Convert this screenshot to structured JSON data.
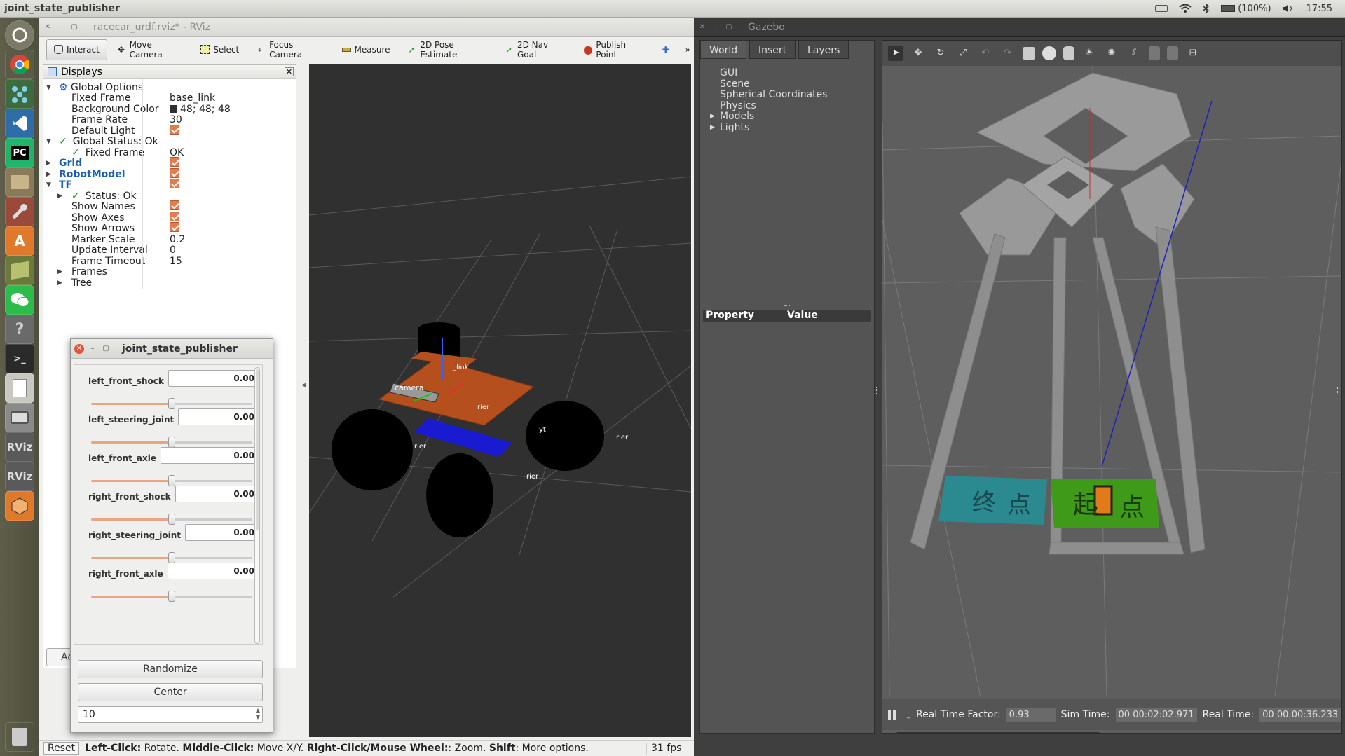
{
  "topbar": {
    "title": "joint_state_publisher",
    "battery": "(100%)",
    "time": "17:55"
  },
  "launcher": {
    "items": [
      "ubuntu-dash-icon",
      "chrome-icon",
      "robot-icon",
      "vscode-icon",
      "pycharm-icon",
      "files-icon",
      "settings-icon",
      "software-center-icon",
      "notes-icon",
      "wechat-icon",
      "help-icon",
      "terminal-icon",
      "text-editor-icon",
      "camera-icon",
      "rviz-icon",
      "rviz-icon",
      "blender-icon",
      "trash-icon"
    ],
    "labels": {
      "rviz": "RViz",
      "pycharm": "PC"
    }
  },
  "rviz": {
    "title": "racecar_urdf.rviz* - RViz",
    "toolbar": [
      "Interact",
      "Move Camera",
      "Select",
      "Focus Camera",
      "Measure",
      "2D Pose Estimate",
      "2D Nav Goal",
      "Publish Point"
    ],
    "displays_title": "Displays",
    "tree": [
      {
        "k": "Global Options",
        "v": "",
        "lvl": 0,
        "arrow": "▼",
        "icon": "gear"
      },
      {
        "k": "Fixed Frame",
        "v": "base_link",
        "lvl": 1
      },
      {
        "k": "Background Color",
        "v": "48; 48; 48",
        "lvl": 1,
        "swatch": "#303030"
      },
      {
        "k": "Frame Rate",
        "v": "30",
        "lvl": 1
      },
      {
        "k": "Default Light",
        "v": "",
        "lvl": 1,
        "check": true
      },
      {
        "k": "Global Status: Ok",
        "v": "",
        "lvl": 0,
        "arrow": "▼",
        "tick": true
      },
      {
        "k": "Fixed Frame",
        "v": "OK",
        "lvl": 1,
        "tick": true
      },
      {
        "k": "Grid",
        "v": "",
        "lvl": 0,
        "arrow": "▶",
        "blue": true,
        "check": true
      },
      {
        "k": "RobotModel",
        "v": "",
        "lvl": 0,
        "arrow": "▶",
        "blue": true,
        "check": true
      },
      {
        "k": "TF",
        "v": "",
        "lvl": 0,
        "arrow": "▼",
        "blue": true,
        "check": true
      },
      {
        "k": "Status: Ok",
        "v": "",
        "lvl": 1,
        "arrow": "▶",
        "tick": true
      },
      {
        "k": "Show Names",
        "v": "",
        "lvl": 1,
        "check": true
      },
      {
        "k": "Show Axes",
        "v": "",
        "lvl": 1,
        "check": true
      },
      {
        "k": "Show Arrows",
        "v": "",
        "lvl": 1,
        "check": true
      },
      {
        "k": "Marker Scale",
        "v": "0.2",
        "lvl": 1
      },
      {
        "k": "Update Interval",
        "v": "0",
        "lvl": 1
      },
      {
        "k": "Frame Timeout",
        "v": "15",
        "lvl": 1
      },
      {
        "k": "Frames",
        "v": "",
        "lvl": 1,
        "arrow": "▶"
      },
      {
        "k": "Tree",
        "v": "",
        "lvl": 1,
        "arrow": "▶"
      }
    ],
    "viewport_labels": [
      "camera",
      "_link",
      "rier",
      "rier",
      "rier",
      "rier",
      "yt"
    ],
    "status": {
      "reset": "Reset",
      "b1": "Left-Click:",
      "t1": " Rotate. ",
      "b2": "Middle-Click:",
      "t2": " Move X/Y. ",
      "b3": "Right-Click/Mouse Wheel:",
      "t3": ": Zoom. ",
      "b4": "Shift",
      "t4": ": More options.",
      "fps": "31 fps"
    },
    "behind_labels": [
      "Ac",
      "ne"
    ]
  },
  "jsp": {
    "title": "joint_state_publisher",
    "joints": [
      {
        "name": "left_front_shock",
        "value": "0.00",
        "pos": 0.5
      },
      {
        "name": "left_steering_joint",
        "value": "0.00",
        "pos": 0.5
      },
      {
        "name": "left_front_axle",
        "value": "0.00",
        "pos": 0.5
      },
      {
        "name": "right_front_shock",
        "value": "0.00",
        "pos": 0.5
      },
      {
        "name": "right_steering_joint",
        "value": "0.00",
        "pos": 0.5
      },
      {
        "name": "right_front_axle",
        "value": "0.00",
        "pos": 0.5
      }
    ],
    "randomize": "Randomize",
    "center": "Center",
    "count": "10"
  },
  "gazebo": {
    "title": "Gazebo",
    "tabs": [
      "World",
      "Insert",
      "Layers"
    ],
    "world_items": [
      "GUI",
      "Scene",
      "Spherical Coordinates",
      "Physics",
      "Models",
      "Lights"
    ],
    "prop_header": [
      "Property",
      "Value"
    ],
    "status": {
      "rtf_label": "Real Time Factor:",
      "rtf": "0.93",
      "sim_label": "Sim Time:",
      "sim": "00 00:02:02.971",
      "real_label": "Real Time:",
      "real": "00 00:00:36.233"
    },
    "floor_text": [
      "终",
      "点",
      "起",
      "点"
    ]
  },
  "colors": {
    "accent_orange": "#e47b4f",
    "rviz_bg": "#303030",
    "gazebo_bg": "#5e5e5e"
  }
}
